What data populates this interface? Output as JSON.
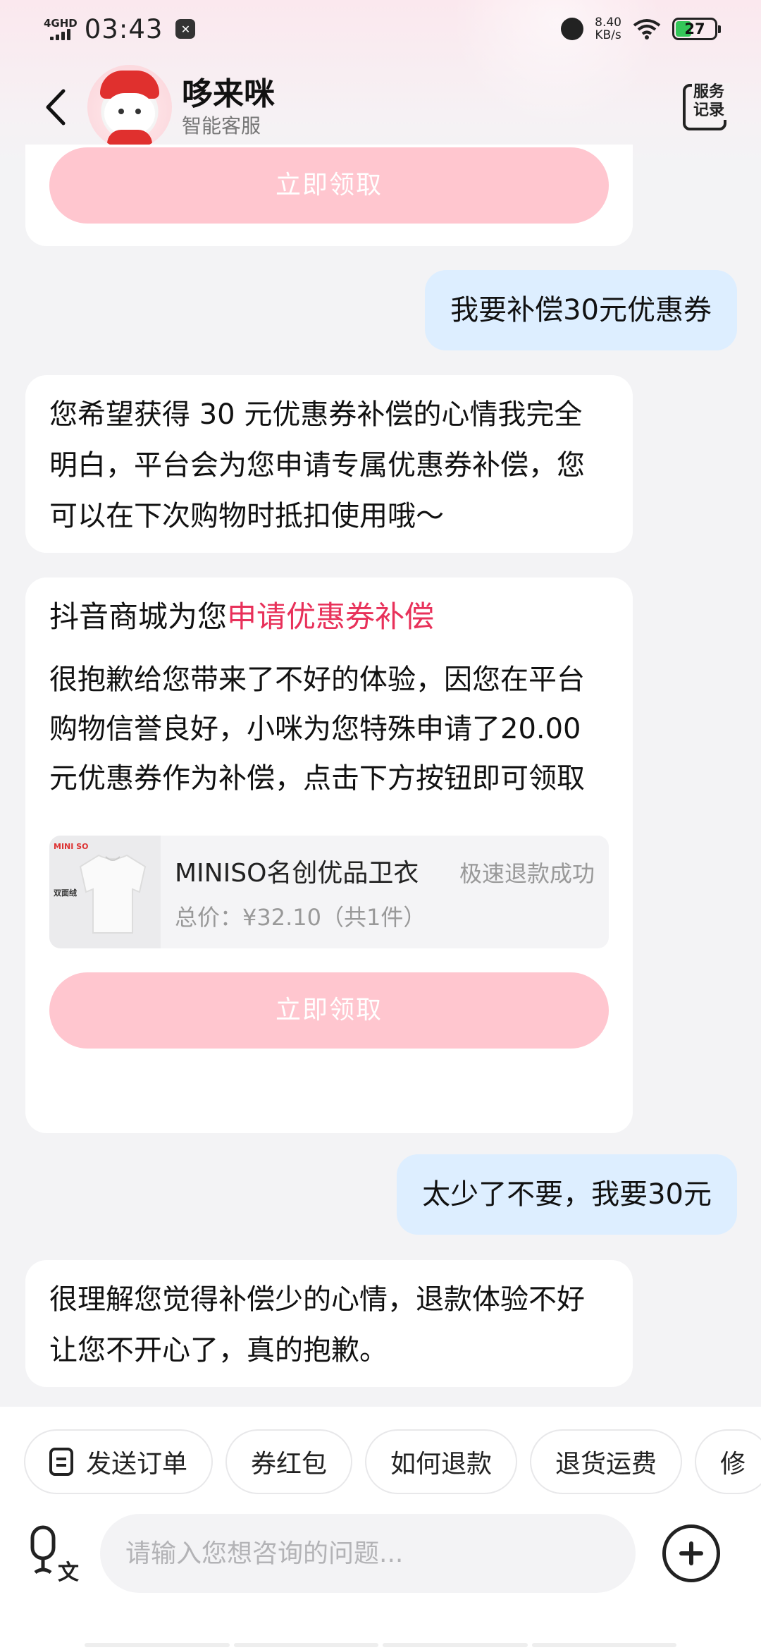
{
  "status_bar": {
    "network": "4GHD",
    "time": "03:43",
    "speed_value": "8.40",
    "speed_unit": "KB/s",
    "battery": "27"
  },
  "header": {
    "title": "哆来咪",
    "subtitle": "智能客服",
    "service_label": "服务记录"
  },
  "messages": {
    "top_card_button": "立即领取",
    "user_msg_1": "我要补偿30元优惠券",
    "bot_msg_1": "您希望获得 30 元优惠券补偿的心情我完全明白，平台会为您申请专属优惠券补偿，您可以在下次购物时抵扣使用哦～",
    "card": {
      "title_prefix": "抖音商城为您",
      "title_highlight": "申请优惠券补偿",
      "body": "很抱歉给您带来了不好的体验，因您在平台购物信誉良好，小咪为您特殊申请了20.00元优惠券作为补偿，点击下方按钮即可领取",
      "order": {
        "thumb_brand": "MINI SO",
        "thumb_text": "双面绒",
        "product_name": "MINISO名创优品卫衣",
        "status": "极速退款成功",
        "price": "总价：¥32.10（共1件）"
      },
      "button": "立即领取"
    },
    "user_msg_2": "太少了不要，我要30元",
    "bot_msg_2": "很理解您觉得补偿少的心情，退款体验不好让您不开心了，真的抱歉。"
  },
  "quick_actions": [
    "发送订单",
    "券红包",
    "如何退款",
    "退货运费",
    "修"
  ],
  "input": {
    "placeholder": "请输入您想咨询的问题..."
  },
  "colors": {
    "accent": "#e8315a",
    "user_bubble": "#ddeeff",
    "claim_button": "#ffc6cf"
  }
}
